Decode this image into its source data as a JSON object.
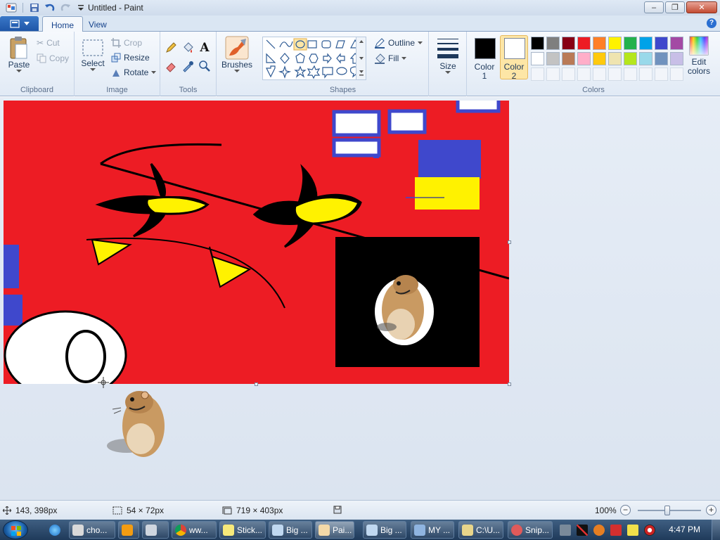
{
  "window": {
    "title": "Untitled - Paint",
    "minimize": "‒",
    "maximize": "❐",
    "close": "✕"
  },
  "tabs": {
    "home": "Home",
    "view": "View"
  },
  "ribbon": {
    "clipboard": {
      "label": "Clipboard",
      "paste": "Paste",
      "cut": "Cut",
      "copy": "Copy"
    },
    "image": {
      "label": "Image",
      "select": "Select",
      "crop": "Crop",
      "resize": "Resize",
      "rotate": "Rotate"
    },
    "tools": {
      "label": "Tools"
    },
    "brushes": {
      "label": "Brushes"
    },
    "shapes": {
      "label": "Shapes",
      "outline": "Outline",
      "fill": "Fill"
    },
    "size": {
      "label": "Size"
    },
    "colors": {
      "label": "Colors",
      "color1_line1": "Color",
      "color1_line2": "1",
      "color2_line1": "Color",
      "color2_line2": "2",
      "edit_line1": "Edit",
      "edit_line2": "colors",
      "color1": "#000000",
      "color2": "#ffffff",
      "palette_row1": [
        "#000000",
        "#7f7f7f",
        "#880015",
        "#ed1c24",
        "#ff7f27",
        "#fff200",
        "#22b14c",
        "#00a2e8",
        "#3f48cc",
        "#a349a4"
      ],
      "palette_row2": [
        "#ffffff",
        "#c3c3c3",
        "#b97a57",
        "#ffaec9",
        "#ffc90e",
        "#efe4b0",
        "#b5e61d",
        "#99d9ea",
        "#7092be",
        "#c8bfe7"
      ]
    }
  },
  "status": {
    "cursor_pos": "143, 398px",
    "selection_size": "54 × 72px",
    "canvas_size": "719 × 403px",
    "zoom": "100%"
  },
  "taskbar": {
    "items": [
      "cho...",
      "",
      "",
      "ww...",
      "Stick...",
      "Big ...",
      "Pai...",
      "Big ...",
      "MY ...",
      "C:\\U...",
      "Snip..."
    ],
    "clock": "4:47 PM"
  },
  "canvas_colors": {
    "background": "#ed1c24",
    "blue": "#3f48cc",
    "yellow": "#fff200"
  }
}
